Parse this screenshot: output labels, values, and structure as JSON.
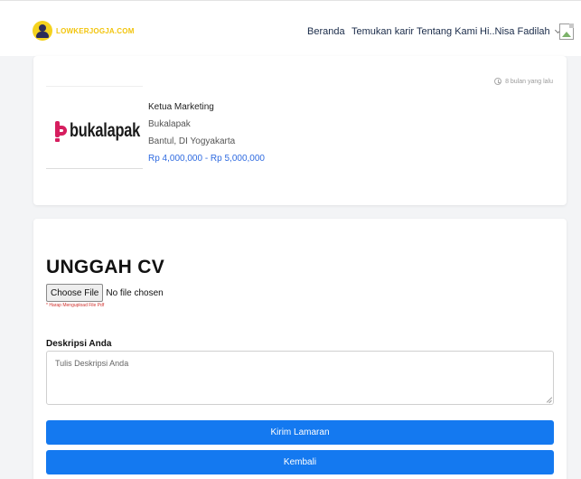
{
  "brand": {
    "logo_text": "LOWKERJOGJA.COM"
  },
  "nav": {
    "home": "Beranda",
    "find_career": "Temukan karir",
    "about": "Tentang Kami",
    "user": "Hi..Nisa Fadilah"
  },
  "job": {
    "posted": "8 bulan yang lalu",
    "company_logo_text": "bukalapak",
    "title": "Ketua Marketing",
    "company": "Bukalapak",
    "location": "Bantul, DI Yogyakarta",
    "salary": "Rp 4,000,000 - Rp 5,000,000"
  },
  "form": {
    "heading": "UNGGAH CV",
    "choose_file_label": "Choose File",
    "file_status": "No file chosen",
    "file_hint": "* Harap Mengupload File Pdf",
    "description_label": "Deskripsi Anda",
    "description_placeholder": "Tulis Deskripsi Anda",
    "description_value": "",
    "submit_label": "Kirim Lamaran",
    "back_label": "Kembali"
  },
  "colors": {
    "accent_blue": "#1479f0",
    "salary_blue": "#2f6be0",
    "brand_yellow": "#f2c40c",
    "bukalapak_red": "#d61e5f",
    "hint_red": "#d0312d"
  },
  "icons": [
    "user-logo-icon",
    "chevron-down-icon",
    "broken-image-icon",
    "clock-icon",
    "bukalapak-logo-icon",
    "resize-grip-icon"
  ]
}
